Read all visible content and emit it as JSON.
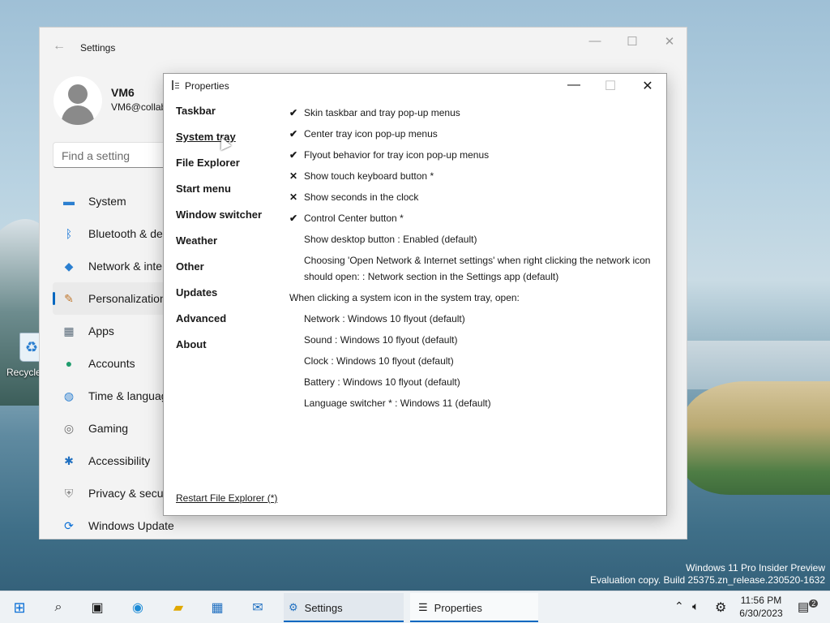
{
  "desktop": {
    "recycle_label": "Recycle"
  },
  "settings": {
    "title": "Settings",
    "user": {
      "name": "VM6",
      "email": "VM6@collab"
    },
    "search": {
      "placeholder": "Find a setting"
    },
    "nav": [
      {
        "label": "System",
        "icon": "monitor-icon"
      },
      {
        "label": "Bluetooth & de",
        "icon": "bluetooth-icon"
      },
      {
        "label": "Network & inte",
        "icon": "wifi-icon"
      },
      {
        "label": "Personalization",
        "icon": "brush-icon"
      },
      {
        "label": "Apps",
        "icon": "apps-icon"
      },
      {
        "label": "Accounts",
        "icon": "account-icon"
      },
      {
        "label": "Time & languag",
        "icon": "globe-icon"
      },
      {
        "label": "Gaming",
        "icon": "gamepad-icon"
      },
      {
        "label": "Accessibility",
        "icon": "accessibility-icon"
      },
      {
        "label": "Privacy & secur",
        "icon": "shield-icon"
      },
      {
        "label": "Windows Update",
        "icon": "update-icon"
      }
    ]
  },
  "props": {
    "title": "Properties",
    "sidebar": [
      "Taskbar",
      "System tray",
      "File Explorer",
      "Start menu",
      "Window switcher",
      "Weather",
      "Other",
      "Updates",
      "Advanced",
      "About"
    ],
    "options": [
      {
        "mark": "✔",
        "text": "Skin taskbar and tray pop-up menus"
      },
      {
        "mark": "✔",
        "text": "Center tray icon pop-up menus"
      },
      {
        "mark": "✔",
        "text": "Flyout behavior for tray icon pop-up menus"
      },
      {
        "mark": "✕",
        "text": "Show touch keyboard button *"
      },
      {
        "mark": "✕",
        "text": "Show seconds in the clock"
      },
      {
        "mark": "✔",
        "text": "Control Center button *"
      },
      {
        "mark": "",
        "text": "Show desktop button : Enabled (default)"
      }
    ],
    "multiline_option": "Choosing 'Open Network & Internet settings' when right clicking the network icon should open: : Network section in the Settings app (default)",
    "section_heading": "When clicking a system icon in the system tray, open:",
    "tray_options": [
      "Network : Windows 10 flyout (default)",
      "Sound : Windows 10 flyout (default)",
      "Clock : Windows 10 flyout (default)",
      "Battery : Windows 10 flyout (default)",
      "Language switcher * : Windows 11 (default)"
    ],
    "restart_link": "Restart File Explorer (*)"
  },
  "watermark": {
    "line1": "Windows 11 Pro Insider Preview",
    "line2": "Evaluation copy. Build 25375.zn_release.230520-1632"
  },
  "taskbar": {
    "apps": [
      {
        "label": "Settings"
      },
      {
        "label": "Properties"
      }
    ],
    "time": "11:56 PM",
    "date": "6/30/2023",
    "notification_count": "2"
  },
  "colors": {
    "accent": "#0067c0"
  }
}
